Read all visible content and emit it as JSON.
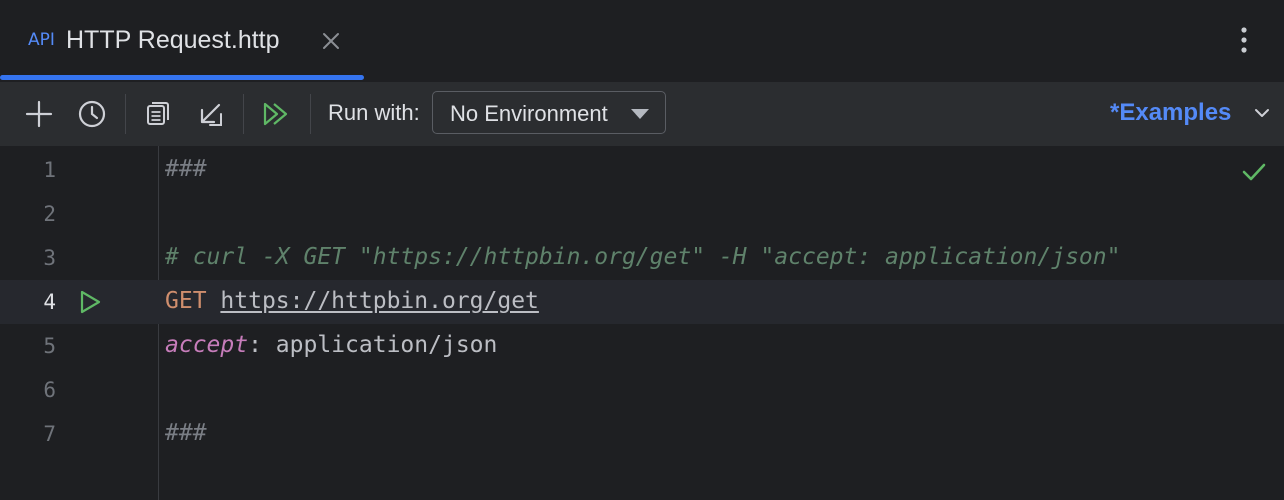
{
  "tab": {
    "icon_text": "API",
    "title": "HTTP Request.http"
  },
  "toolbar": {
    "run_with_label": "Run with:",
    "environment_selected": "No Environment",
    "examples_label": "*Examples"
  },
  "editor": {
    "lines": [
      {
        "number": "1",
        "text": "###"
      },
      {
        "number": "2",
        "text": ""
      },
      {
        "number": "3",
        "text": "# curl -X GET \"https://httpbin.org/get\" -H \"accept: application/json\""
      },
      {
        "number": "4",
        "method": "GET",
        "url": "https://httpbin.org/get"
      },
      {
        "number": "5",
        "header_key": "accept",
        "colon": ":",
        "header_value": " application/json"
      },
      {
        "number": "6",
        "text": ""
      },
      {
        "number": "7",
        "text": "###"
      }
    ]
  },
  "colors": {
    "accent": "#3574f0",
    "link": "#548af7",
    "run_green": "#5fb865",
    "comment": "#5f826b",
    "method": "#cf8e6d",
    "header_key": "#c77dbb"
  }
}
